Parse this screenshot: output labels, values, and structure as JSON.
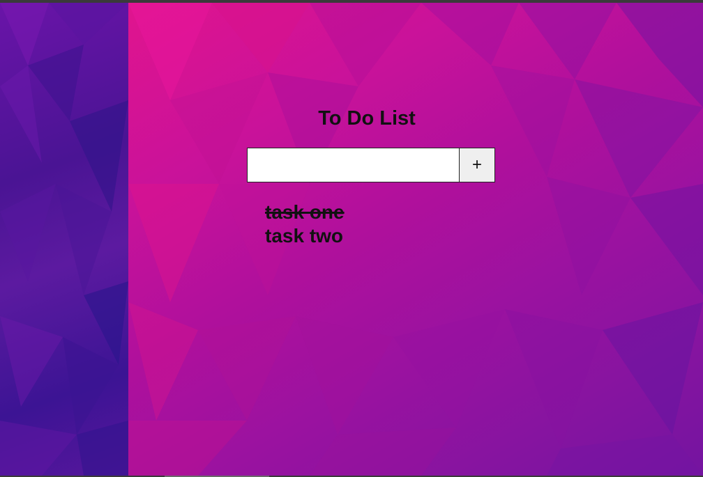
{
  "app": {
    "title": "To Do List",
    "input": {
      "value": "",
      "placeholder": ""
    },
    "add_button_label": "+"
  },
  "tasks": [
    {
      "text": "task one",
      "completed": true
    },
    {
      "text": "task two",
      "completed": false
    }
  ],
  "colors": {
    "background_primary": "#c9129a",
    "background_secondary": "#4a1494",
    "text": "#111111",
    "input_bg": "#ffffff",
    "button_bg": "#efefef"
  }
}
